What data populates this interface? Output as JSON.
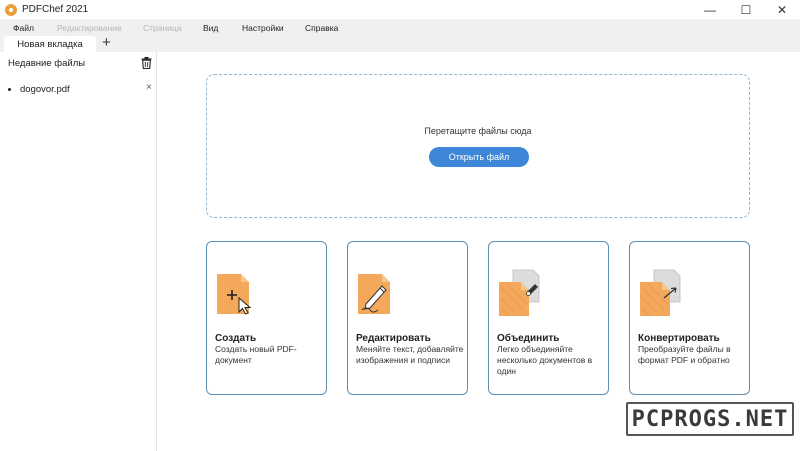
{
  "window": {
    "title": "PDFChef 2021",
    "controls": [
      "minimize-icon",
      "maximize-icon",
      "close-icon"
    ]
  },
  "menu": [
    {
      "label": "Файл",
      "enabled": true
    },
    {
      "label": "Редактирование",
      "enabled": false
    },
    {
      "label": "Страница",
      "enabled": false
    },
    {
      "label": "Вид",
      "enabled": true
    },
    {
      "label": "Настройки",
      "enabled": true
    },
    {
      "label": "Справка",
      "enabled": true
    }
  ],
  "tabs": {
    "active_label": "Новая вкладка",
    "add_icon": "+"
  },
  "sidebar": {
    "heading": "Недавние файлы",
    "trash_icon": "trash-icon",
    "recent": [
      {
        "name": "dogovor.pdf",
        "remove_glyph": "×"
      }
    ]
  },
  "dropzone": {
    "hint": "Перетащите файлы сюда",
    "open_button": "Открыть файл"
  },
  "cards": [
    {
      "title": "Создать",
      "desc": "Создать новый PDF-документ",
      "icon": "create-doc-icon"
    },
    {
      "title": "Редактировать",
      "desc": "Меняйте текст, добавляйте изображения и подписи",
      "icon": "edit-doc-icon"
    },
    {
      "title": "Объединить",
      "desc": "Легко объединяйте несколько документов в один",
      "icon": "merge-doc-icon"
    },
    {
      "title": "Конвертировать",
      "desc": "Преобразуйте файлы в формат PDF и обратно",
      "icon": "convert-doc-icon"
    }
  ],
  "watermark": {
    "text": "PCPROGS.NET"
  },
  "colors": {
    "accent": "#3d86d8",
    "card_border": "#5e8fb4",
    "doc_orange": "#f4a85b",
    "menubar": "#f0f0f0"
  }
}
